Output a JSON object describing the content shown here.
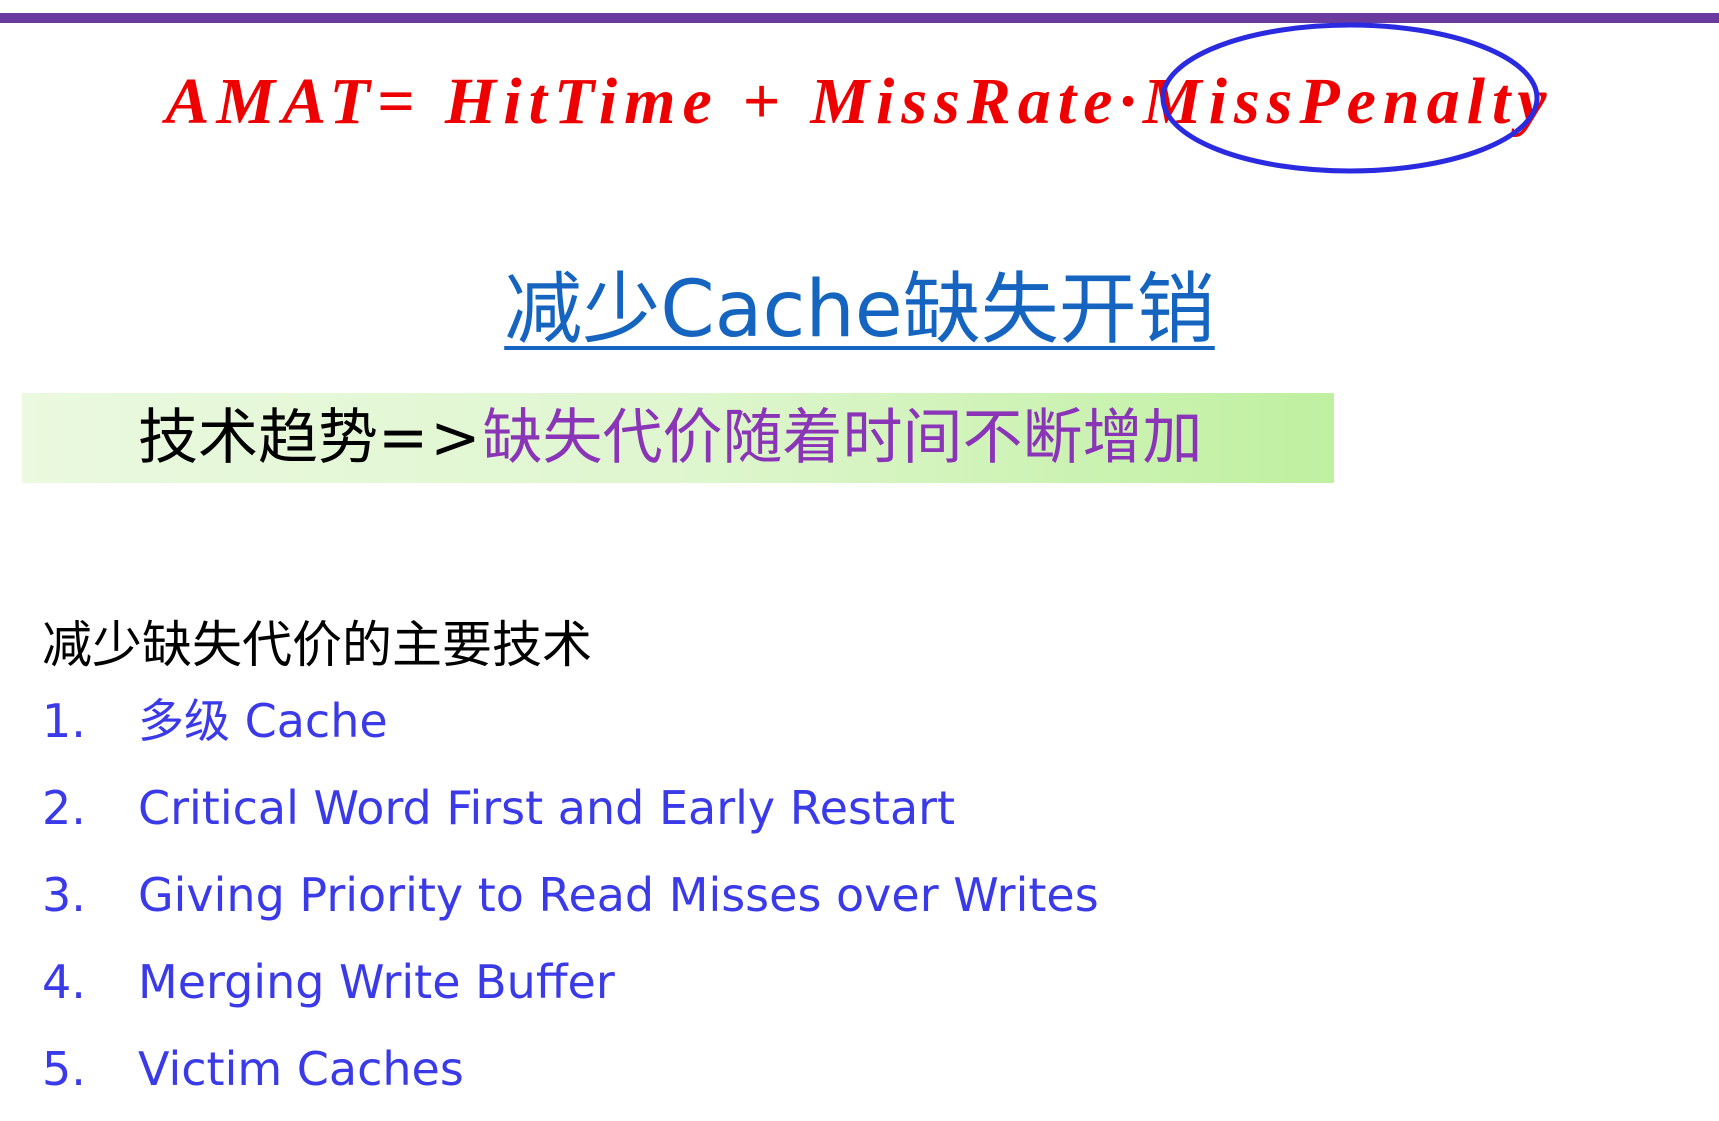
{
  "formula": {
    "lhs": "AMAT",
    "equals": "=",
    "hit_time": "HitTime",
    "plus": "+",
    "miss_rate": "MissRate",
    "dot": "·",
    "miss_penalty": "MissPenalty"
  },
  "title": "减少Cache缺失开销",
  "trend": {
    "prefix": "技术趋势",
    "arrow": "=>",
    "suffix": "缺失代价随着时间不断增加"
  },
  "subheading": "减少缺失代价的主要技术",
  "techniques": [
    {
      "number": "1.",
      "label": "多级 Cache"
    },
    {
      "number": "2.",
      "label": "Critical Word First and Early Restart"
    },
    {
      "number": "3.",
      "label": "Giving Priority to Read Misses over Writes"
    },
    {
      "number": "4.",
      "label": "Merging Write Buffer"
    },
    {
      "number": "5.",
      "label": "Victim Caches"
    }
  ],
  "colors": {
    "rule": "#6b3a9e",
    "formula": "#ee0000",
    "highlight_circle": "#2a2ae0",
    "title": "#1565c0",
    "trend_suffix": "#8a34b8",
    "list": "#3a3ae8"
  }
}
